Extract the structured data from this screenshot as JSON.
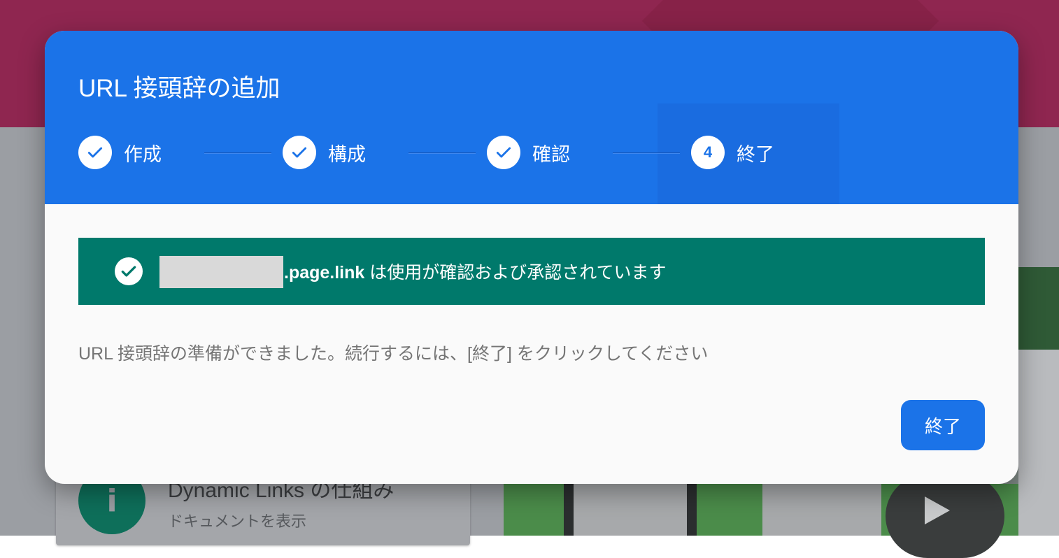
{
  "background": {
    "card_title": "Dynamic Links の仕組み",
    "card_subtitle": "ドキュメントを表示",
    "info_icon": "i"
  },
  "dialog": {
    "title": "URL 接頭辞の追加",
    "steps": [
      {
        "label": "作成",
        "status": "done",
        "icon": "check-icon"
      },
      {
        "label": "構成",
        "status": "done",
        "icon": "check-icon"
      },
      {
        "label": "確認",
        "status": "done",
        "icon": "check-icon"
      },
      {
        "label": "終了",
        "status": "current",
        "number": "4"
      }
    ],
    "banner": {
      "domain_suffix": ".page.link",
      "message": " は使用が確認および承認されています"
    },
    "ready_message": "URL 接頭辞の準備ができました。続行するには、[終了] をクリックしてください",
    "finish_button": "終了"
  },
  "colors": {
    "header": "#1b73e8",
    "banner": "#00796b",
    "button": "#1b73e8"
  }
}
